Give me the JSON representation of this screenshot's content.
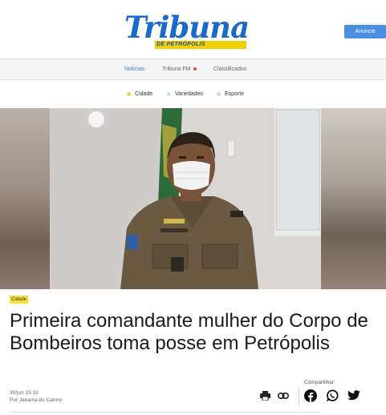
{
  "header": {
    "logo_text": "Tribuna",
    "logo_subtitle": "DE PETRÓPOLIS",
    "cta_label": "Anuncie"
  },
  "nav": {
    "items": [
      {
        "label": "Notícias",
        "active": true
      },
      {
        "label": "Tribuna FM",
        "live": true
      },
      {
        "label": "Classificados"
      }
    ]
  },
  "categories": [
    {
      "label": "Cidade",
      "color": "#f0d24a"
    },
    {
      "label": "Variedades",
      "color": "#c5e0f5"
    },
    {
      "label": "Esporte",
      "color": "#f5c6d0"
    }
  ],
  "article": {
    "tag": "Cidade",
    "headline": "Primeira comandante mulher do Corpo de Bombeiros toma posse em Petrópolis",
    "date": "30/jun 15:10",
    "author": "Por Janaina do Carmo"
  },
  "share": {
    "label": "Compartilhar:",
    "icons": [
      "print-icon",
      "link-icon",
      "facebook-icon",
      "whatsapp-icon",
      "twitter-icon"
    ]
  },
  "colors": {
    "brand_blue": "#1a6ac9",
    "brand_yellow": "#f3d100",
    "cta_blue": "#4a90e2",
    "tag_yellow": "#f3e23a"
  }
}
